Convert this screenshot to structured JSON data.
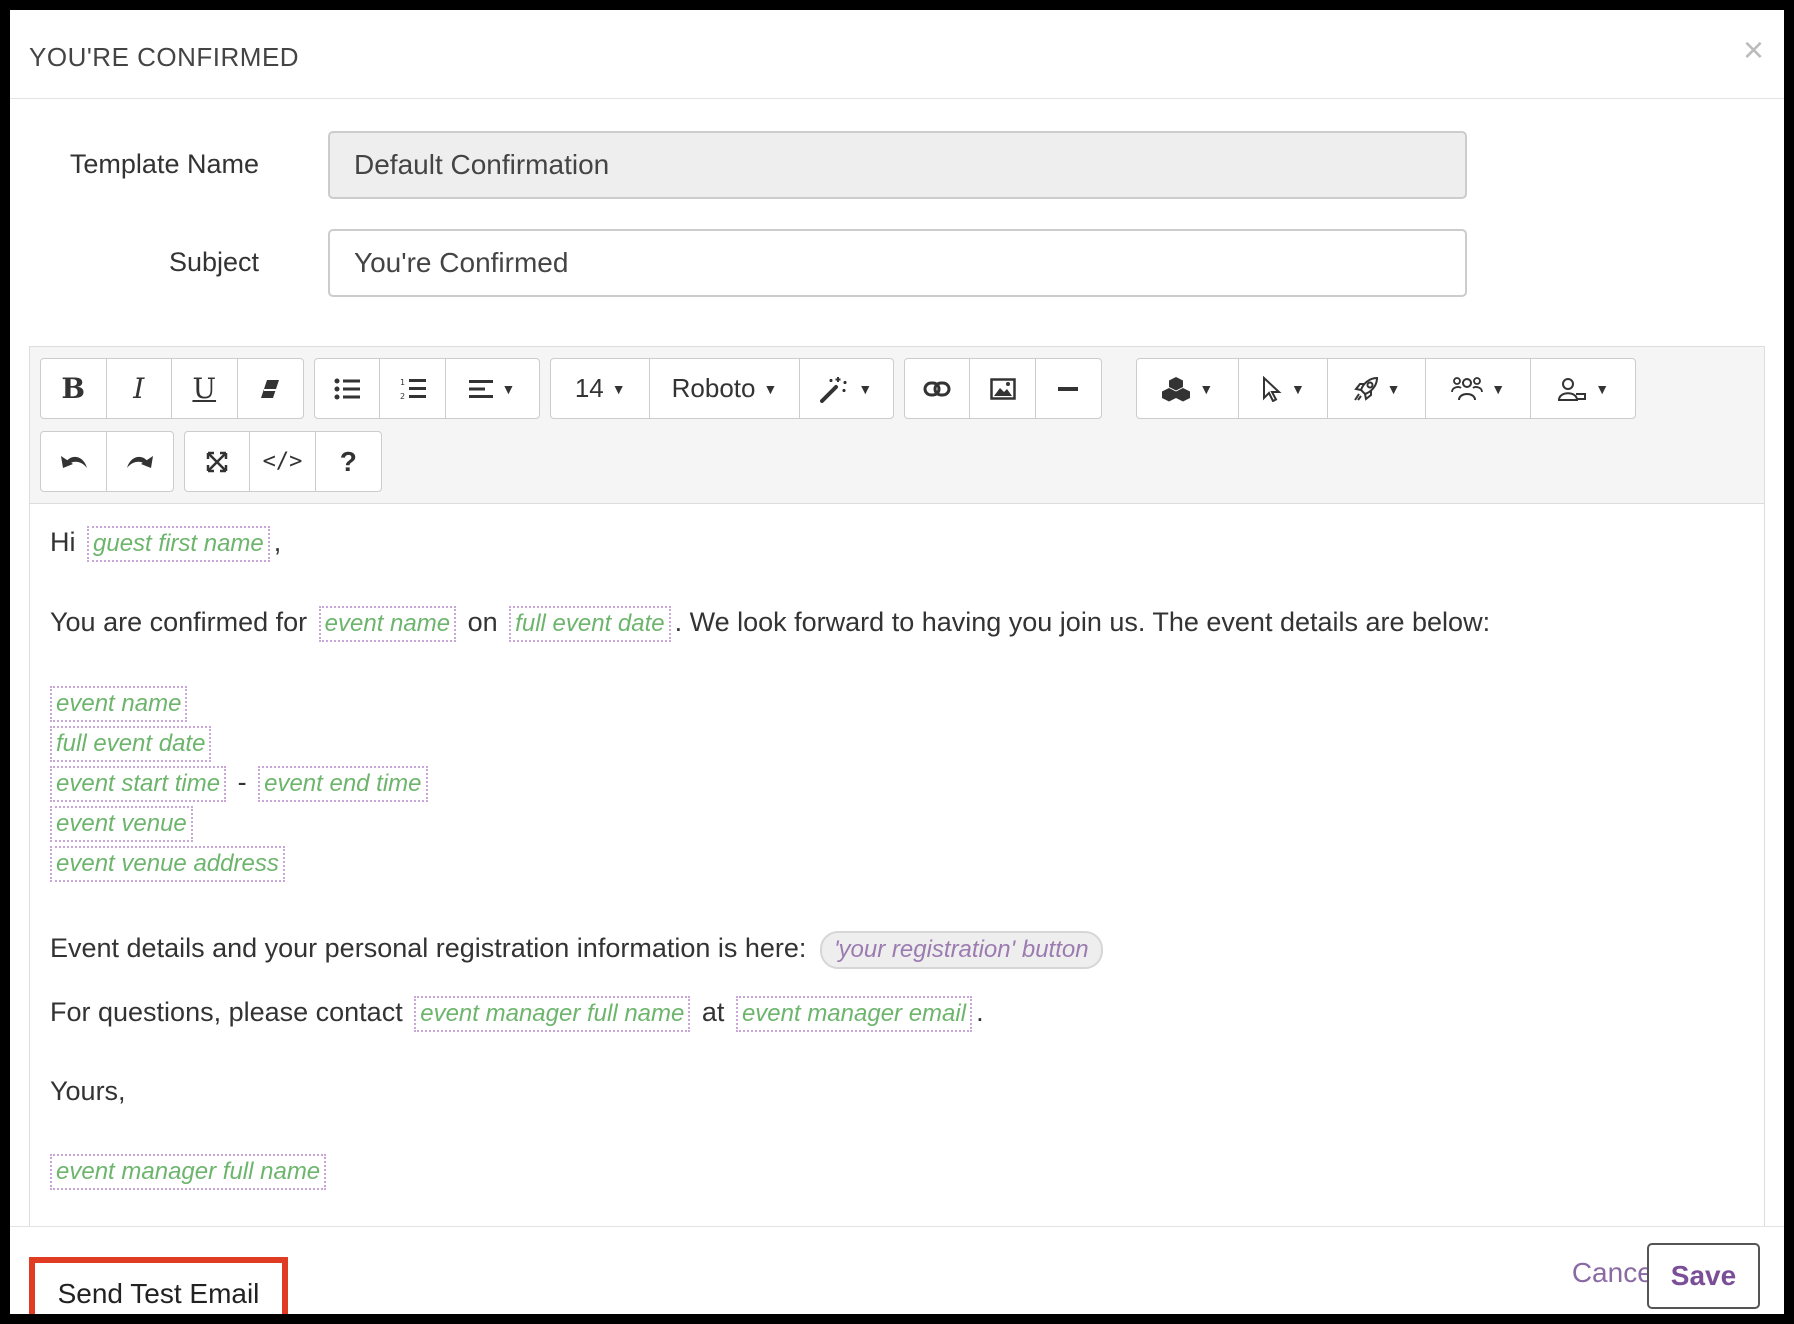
{
  "modal": {
    "title": "YOU'RE CONFIRMED",
    "close_label": "×"
  },
  "form": {
    "template_name_label": "Template Name",
    "template_name_value": "Default Confirmation",
    "subject_label": "Subject",
    "subject_value": "You're Confirmed"
  },
  "toolbar": {
    "font_size": "14",
    "font_family": "Roboto",
    "icons": [
      "bold-icon",
      "italic-icon",
      "underline-icon",
      "eraser-icon",
      "unordered-list-icon",
      "ordered-list-icon",
      "align-icon",
      "style-magic-icon",
      "link-icon",
      "image-icon",
      "horizontal-rule-icon",
      "cubes-icon",
      "pointer-icon",
      "rocket-icon",
      "users-icon",
      "user-icon",
      "undo-icon",
      "redo-icon",
      "fullscreen-icon",
      "code-view-icon",
      "help-icon"
    ]
  },
  "content": {
    "greeting": "Hi",
    "greeting_suffix": ",",
    "confirmed_prefix": "You are confirmed for",
    "on_word": "on",
    "confirmed_suffix": ". We look forward to having you join us. The event details are below:",
    "dash": "-",
    "registration_text": "Event details and your personal registration information is here:",
    "questions_text": "For questions, please contact",
    "at_word": "at",
    "period": ".",
    "closing": "Yours,",
    "tags": {
      "guest_first_name": "guest first name",
      "event_name": "event name",
      "full_event_date": "full event date",
      "event_start_time": "event start time",
      "event_end_time": "event end time",
      "event_venue": "event venue",
      "event_venue_address": "event venue address",
      "registration_button": "'your registration' button",
      "event_manager_full_name": "event manager full name",
      "event_manager_email": "event manager email"
    }
  },
  "footer": {
    "send_test_label": "Send Test Email",
    "cancel_label": "Cancel",
    "save_label": "Save"
  },
  "colors": {
    "accent": "#7a4f97",
    "tag_text": "#6db56d",
    "tag_border": "#c9a6d8",
    "highlight": "#e03c24"
  }
}
